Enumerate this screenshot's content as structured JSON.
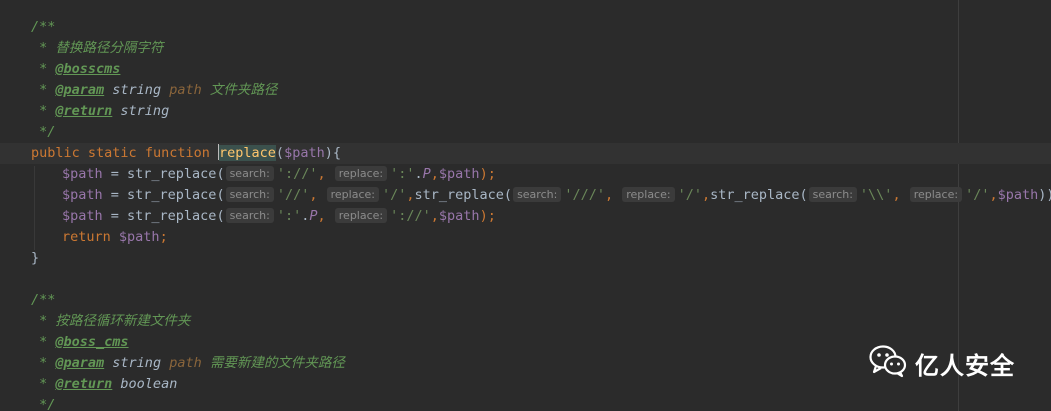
{
  "editor": {
    "lines": [
      {
        "kind": "doc_open",
        "text": "/**"
      },
      {
        "kind": "doc_text",
        "star": " * ",
        "text": "替换路径分隔字符"
      },
      {
        "kind": "doc_tag",
        "star": " * ",
        "tag": "@bosscms"
      },
      {
        "kind": "doc_param",
        "star": " * ",
        "tag": "@param",
        "type": " string ",
        "name": "path",
        "desc": " 文件夹路径"
      },
      {
        "kind": "doc_return",
        "star": " * ",
        "tag": "@return",
        "type": " string"
      },
      {
        "kind": "doc_close",
        "text": " */"
      },
      {
        "kind": "func_sig",
        "kw1": "public",
        "kw2": "static",
        "kw3": "function",
        "fname": "replace",
        "paren_open": "(",
        "param": "$path",
        "paren_close": "){"
      },
      {
        "kind": "code1"
      },
      {
        "kind": "code2"
      },
      {
        "kind": "code3"
      },
      {
        "kind": "ret",
        "kw": "return",
        "var": "$path",
        "end": ";"
      },
      {
        "kind": "brace",
        "text": "}"
      },
      {
        "kind": "blank"
      },
      {
        "kind": "doc_open",
        "text": "/**"
      },
      {
        "kind": "doc_text",
        "star": " * ",
        "text": "按路径循环新建文件夹"
      },
      {
        "kind": "doc_tag",
        "star": " * ",
        "tag": "@boss_cms"
      },
      {
        "kind": "doc_param",
        "star": " * ",
        "tag": "@param",
        "type": " string ",
        "name": "path",
        "desc": " 需要新建的文件夹路径"
      },
      {
        "kind": "doc_return",
        "star": " * ",
        "tag": "@return",
        "type": " boolean"
      },
      {
        "kind": "doc_close",
        "text": " */"
      }
    ],
    "code1": {
      "var": "$path",
      "eq": " = ",
      "fn": "str_replace",
      "open": "(",
      "hint_search": "search:",
      "s1": "'://'",
      "comma1": ",",
      "hint_replace": "replace:",
      "s2": "':'",
      "dot": ".",
      "const": "P",
      "comma2": ",",
      "arg": "$path",
      "close": ");"
    },
    "code2": {
      "var": "$path",
      "eq": " = ",
      "fn": "str_replace",
      "open": "(",
      "hint_search": "search:",
      "s1": "'//'",
      "comma1": ",",
      "hint_replace": "replace:",
      "s2": "'/'",
      "comma2": ",",
      "fn2": "str_replace",
      "open2": "(",
      "hint_search2": "search:",
      "s3": "'///'",
      "comma3": ",",
      "hint_replace2": "replace:",
      "s4": "'/'",
      "comma4": ",",
      "fn3": "str_replace",
      "open3": "(",
      "hint_search3": "search:",
      "s5": "'\\\\'",
      "comma5": ",",
      "hint_replace3": "replace:",
      "s6": "'/'",
      "comma6": ",",
      "arg": "$path",
      "close": ")));"
    },
    "code3": {
      "var": "$path",
      "eq": " = ",
      "fn": "str_replace",
      "open": "(",
      "hint_search": "search:",
      "s1": "':'",
      "dot": ".",
      "const": "P",
      "comma1": ",",
      "hint_replace": "replace:",
      "s2": "'://'",
      "comma2": ",",
      "arg": "$path",
      "close": ");"
    }
  },
  "watermark": {
    "text": "亿人安全",
    "icon": "wechat-icon"
  },
  "colors": {
    "background": "#2b2b2b",
    "comment": "#629755",
    "keyword": "#cc7832",
    "function_highlight": "#ffc66d",
    "variable": "#9876aa",
    "string": "#6a8759"
  }
}
